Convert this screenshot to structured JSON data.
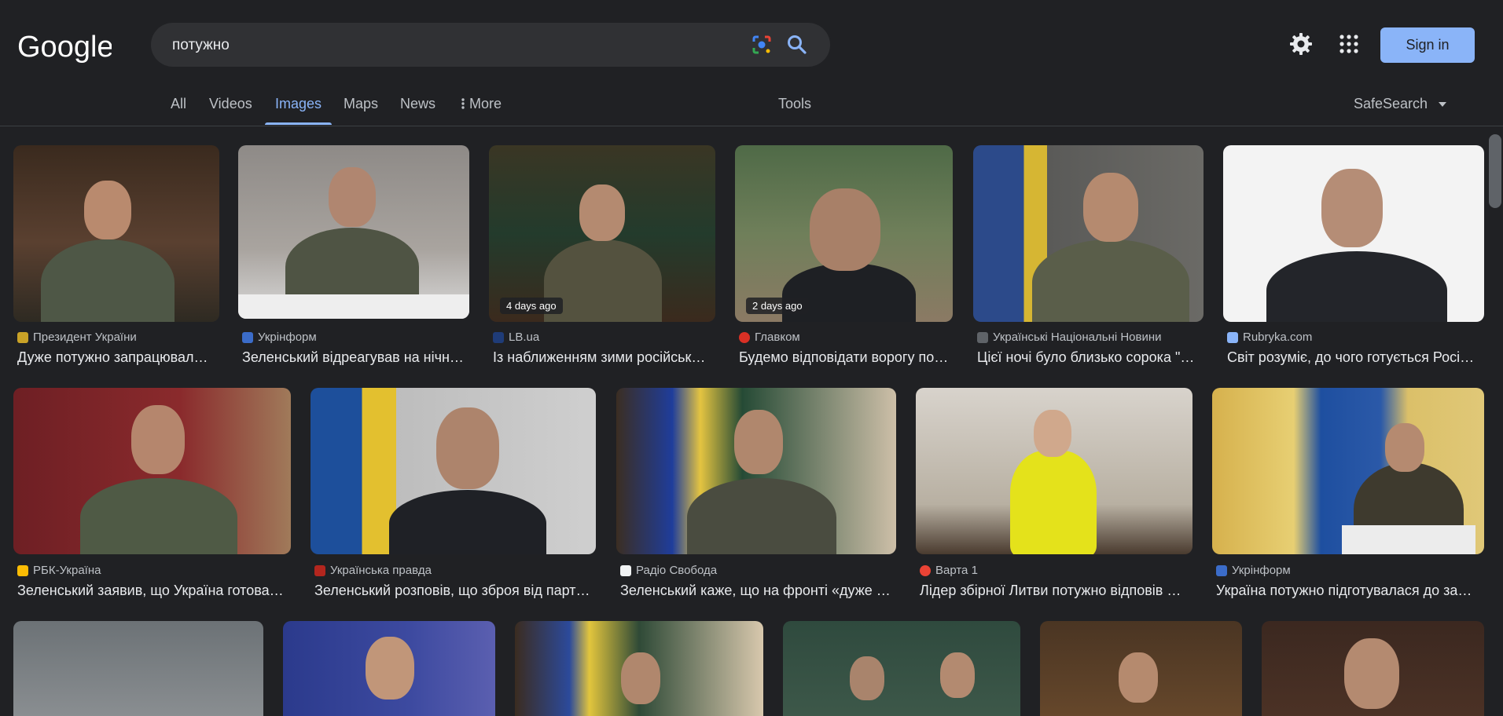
{
  "search": {
    "query": "потужно"
  },
  "header": {
    "sign_in": "Sign in"
  },
  "nav": {
    "tabs": [
      "All",
      "Videos",
      "Images",
      "Maps",
      "News",
      "More"
    ],
    "tools": "Tools",
    "safesearch": "SafeSearch"
  },
  "colors": {
    "accent": "#8ab4f8",
    "background": "#202124"
  },
  "results": [
    {
      "source": "Президент України",
      "title": "Дуже потужно запрацювал…",
      "badge": ""
    },
    {
      "source": "Укрінформ",
      "title": "Зеленський відреагував на нічн…",
      "badge": ""
    },
    {
      "source": "LB.ua",
      "title": "Із наближенням зими російськ…",
      "badge": "4 days ago"
    },
    {
      "source": "Главком",
      "title": "Будемо відповідати ворогу по…",
      "badge": "2 days ago"
    },
    {
      "source": "Українські Національні Новини",
      "title": "Цієї ночі було близько сорока \"…",
      "badge": ""
    },
    {
      "source": "Rubryka.com",
      "title": "Світ розуміє, до чого готується Росі…",
      "badge": ""
    },
    {
      "source": "РБК-Україна",
      "title": "Зеленський заявив, що Україна готова…",
      "badge": ""
    },
    {
      "source": "Українська правда",
      "title": "Зеленський розповів, що зброя від парт…",
      "badge": ""
    },
    {
      "source": "Радіо Свобода",
      "title": "Зеленський каже, що на фронті «дуже …",
      "badge": ""
    },
    {
      "source": "Варта 1",
      "title": "Лідер збірної Литви потужно відповів …",
      "badge": ""
    },
    {
      "source": "Укрінформ",
      "title": "Україна потужно підготувалася до за…",
      "badge": ""
    }
  ]
}
